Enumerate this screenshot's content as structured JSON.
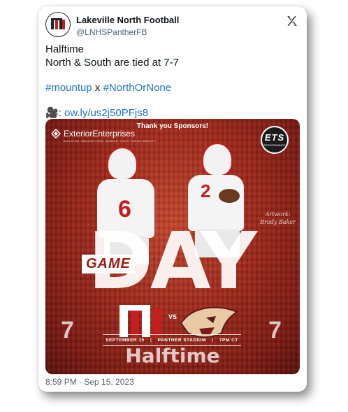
{
  "tweet": {
    "author_name": "Lakeville North Football",
    "author_handle": "@LNHSPantherFB",
    "text_line1": "Halftime",
    "text_line2": "North & South are tied at 7-7",
    "hashtag1": "#mountup",
    "hashtag_sep": " x ",
    "hashtag2": "#NorthOrNone",
    "video_emoji": "🎥",
    "link_prefix": ": ",
    "link": "ow.ly/us2j50PFjs8",
    "timestamp": "8:59 PM · Sep 15, 2023"
  },
  "image": {
    "sponsor_title": "Thank you Sponsors!",
    "sponsor1_name": "ExteriorEnterprises",
    "sponsor1_tagline": "BUILDING INNOVATIONS, ADDING YOUR VISION BEAUTY",
    "sponsor2_name": "ETS",
    "sponsor2_sub": "PERFORMANCE",
    "artwork_line1": "Artwork:",
    "artwork_line2": "Brody Baker",
    "game_label": "GAME",
    "day_label": "DAY",
    "player1_number": "6",
    "player2_number": "2",
    "vs_label": "VS",
    "score_left": "7",
    "score_right": "7",
    "date": "SEPTEMBER 15",
    "venue": "PANTHER STADIUM",
    "time": "7PM CT",
    "status": "Halftime"
  },
  "colors": {
    "link_blue": "#1d74c8",
    "team_red": "#c41e1e"
  },
  "icons": {
    "x_logo": "x-logo-icon",
    "video": "movie-camera-icon"
  }
}
